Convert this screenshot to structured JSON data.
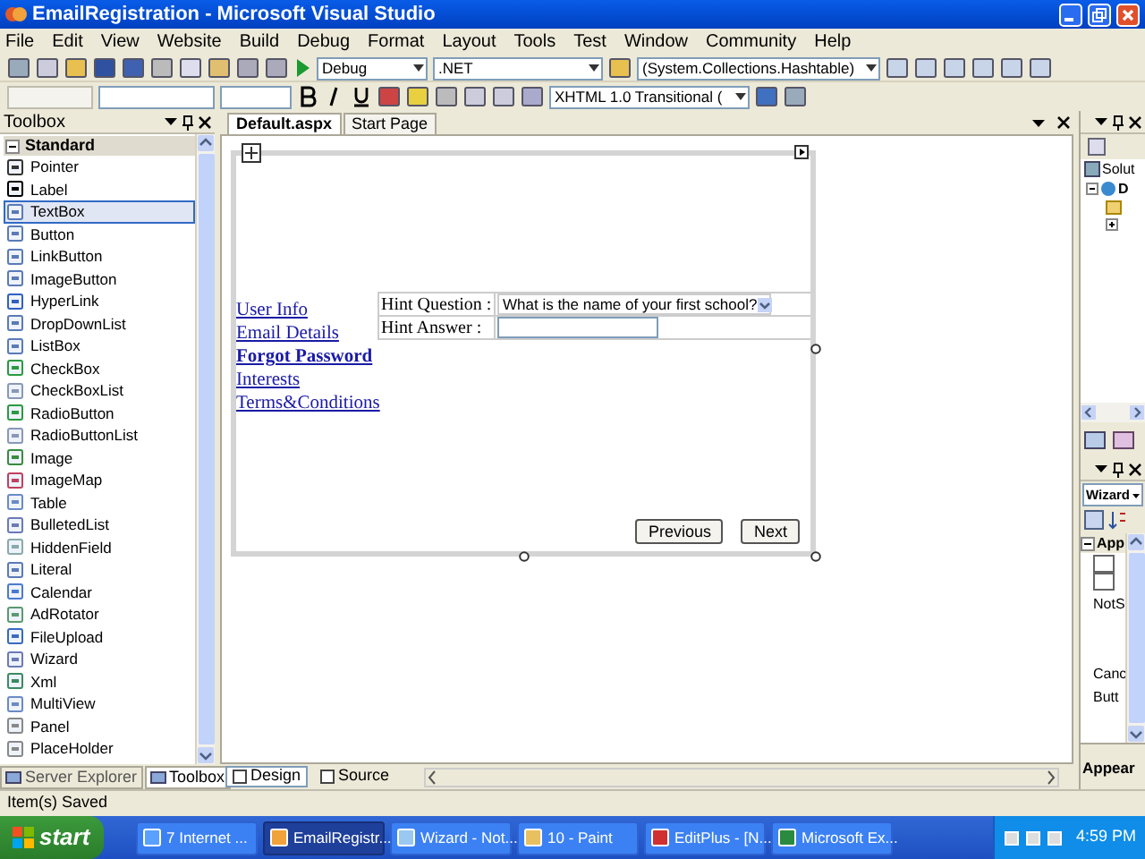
{
  "window": {
    "title": "EmailRegistration - Microsoft Visual Studio"
  },
  "menu": [
    "File",
    "Edit",
    "View",
    "Website",
    "Build",
    "Debug",
    "Format",
    "Layout",
    "Tools",
    "Test",
    "Window",
    "Community",
    "Help"
  ],
  "toolbar": {
    "configuration": "Debug",
    "platform": ".NET",
    "object": "(System.Collections.Hashtable)",
    "doctype": "XHTML 1.0 Transitional ("
  },
  "toolbox": {
    "title": "Toolbox",
    "group": "Standard",
    "items": [
      {
        "label": "Pointer",
        "selected": false
      },
      {
        "label": "Label",
        "selected": false
      },
      {
        "label": "TextBox",
        "selected": true
      },
      {
        "label": "Button",
        "selected": false
      },
      {
        "label": "LinkButton",
        "selected": false
      },
      {
        "label": "ImageButton",
        "selected": false
      },
      {
        "label": "HyperLink",
        "selected": false
      },
      {
        "label": "DropDownList",
        "selected": false
      },
      {
        "label": "ListBox",
        "selected": false
      },
      {
        "label": "CheckBox",
        "selected": false
      },
      {
        "label": "CheckBoxList",
        "selected": false
      },
      {
        "label": "RadioButton",
        "selected": false
      },
      {
        "label": "RadioButtonList",
        "selected": false
      },
      {
        "label": "Image",
        "selected": false
      },
      {
        "label": "ImageMap",
        "selected": false
      },
      {
        "label": "Table",
        "selected": false
      },
      {
        "label": "BulletedList",
        "selected": false
      },
      {
        "label": "HiddenField",
        "selected": false
      },
      {
        "label": "Literal",
        "selected": false
      },
      {
        "label": "Calendar",
        "selected": false
      },
      {
        "label": "AdRotator",
        "selected": false
      },
      {
        "label": "FileUpload",
        "selected": false
      },
      {
        "label": "Wizard",
        "selected": false
      },
      {
        "label": "Xml",
        "selected": false
      },
      {
        "label": "MultiView",
        "selected": false
      },
      {
        "label": "Panel",
        "selected": false
      },
      {
        "label": "PlaceHolder",
        "selected": false
      }
    ]
  },
  "document_tabs": [
    {
      "label": "Default.aspx",
      "selected": true
    },
    {
      "label": "Start Page",
      "selected": false
    }
  ],
  "wizard": {
    "steps": [
      {
        "label": "User Info",
        "selected": false
      },
      {
        "label": "Email Details",
        "selected": false
      },
      {
        "label": "Forgot Password",
        "selected": true
      },
      {
        "label": "Interests",
        "selected": false
      },
      {
        "label": "Terms&Conditions",
        "selected": false
      }
    ],
    "fields": [
      {
        "label": "Hint Question :",
        "kind": "dropdown",
        "value": "What is the name of your first school?"
      },
      {
        "label": "Hint Answer :",
        "kind": "text"
      }
    ],
    "buttons": [
      "Previous",
      "Next"
    ]
  },
  "view_tabs": [
    {
      "label": "Design",
      "selected": true
    },
    {
      "label": "Source",
      "selected": false
    }
  ],
  "bottom_tabs": [
    {
      "label": "Server Explorer",
      "selected": false
    },
    {
      "label": "Toolbox",
      "selected": true
    }
  ],
  "solution_explorer": {
    "items": [
      {
        "label": "Solut"
      },
      {
        "label": "D"
      }
    ]
  },
  "properties": {
    "object": "Wizard",
    "category": "App",
    "values": [
      "NotS",
      "Canc",
      "Butt"
    ],
    "description": "Appear"
  },
  "status_bar": "Item(s) Saved",
  "taskbar": {
    "start": "start",
    "tasks": [
      {
        "label": "7 Internet ...",
        "selected": false
      },
      {
        "label": "EmailRegistr...",
        "selected": true
      },
      {
        "label": "Wizard - Not...",
        "selected": false
      },
      {
        "label": "10 - Paint",
        "selected": false
      },
      {
        "label": "EditPlus - [N...",
        "selected": false
      },
      {
        "label": "Microsoft Ex...",
        "selected": false
      }
    ],
    "clock": "4:59 PM"
  }
}
